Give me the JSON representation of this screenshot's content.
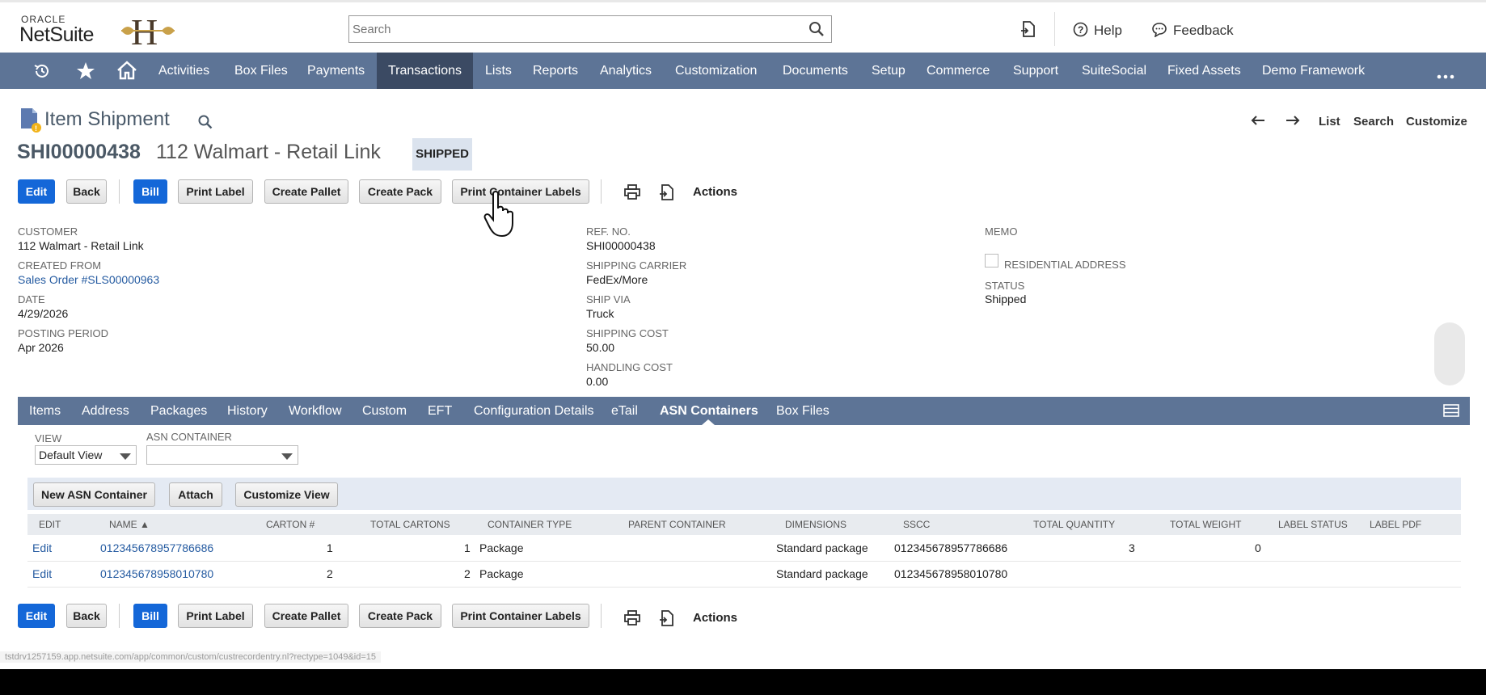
{
  "header": {
    "logo_oracle": "ORACLE",
    "logo_netsuite": "NetSuite",
    "search_placeholder": "Search",
    "help_label": "Help",
    "feedback_label": "Feedback"
  },
  "nav": {
    "items": [
      "Activities",
      "Box Files",
      "Payments",
      "Transactions",
      "Lists",
      "Reports",
      "Analytics",
      "Customization",
      "Documents",
      "Setup",
      "Commerce",
      "Support",
      "SuiteSocial",
      "Fixed Assets",
      "Demo Framework"
    ],
    "active": "Transactions"
  },
  "page": {
    "title": "Item Shipment",
    "record_id": "SHI00000438",
    "record_name": "112 Walmart - Retail Link",
    "status_badge": "SHIPPED",
    "nav_list": "List",
    "nav_search": "Search",
    "nav_customize": "Customize"
  },
  "buttons": {
    "edit": "Edit",
    "back": "Back",
    "bill": "Bill",
    "print_label": "Print Label",
    "create_pallet": "Create Pallet",
    "create_pack": "Create Pack",
    "print_container_labels": "Print Container Labels",
    "actions": "Actions"
  },
  "fields": {
    "customer_label": "Customer",
    "customer_value": "112 Walmart - Retail Link",
    "created_from_label": "Created From",
    "created_from_value": "Sales Order #SLS00000963",
    "date_label": "Date",
    "date_value": "4/29/2026",
    "posting_period_label": "Posting Period",
    "posting_period_value": "Apr 2026",
    "ref_no_label": "Ref. No.",
    "ref_no_value": "SHI00000438",
    "shipping_carrier_label": "Shipping Carrier",
    "shipping_carrier_value": "FedEx/More",
    "ship_via_label": "Ship Via",
    "ship_via_value": "Truck",
    "shipping_cost_label": "Shipping Cost",
    "shipping_cost_value": "50.00",
    "handling_cost_label": "Handling Cost",
    "handling_cost_value": "0.00",
    "memo_label": "Memo",
    "residential_label": "Residential Address",
    "status_label": "Status",
    "status_value": "Shipped"
  },
  "subtabs": {
    "items": [
      "Items",
      "Address",
      "Packages",
      "History",
      "Workflow",
      "Custom",
      "EFT",
      "Configuration Details",
      "eTail",
      "ASN Containers",
      "Box Files"
    ],
    "active": "ASN Containers"
  },
  "sublist": {
    "view_label": "View",
    "view_value": "Default View",
    "asn_label": "ASN Container",
    "asn_value": "",
    "new_button": "New ASN Container",
    "attach_button": "Attach",
    "customize_button": "Customize View",
    "columns": [
      "EDIT",
      "NAME ▲",
      "CARTON #",
      "TOTAL CARTONS",
      "CONTAINER TYPE",
      "PARENT CONTAINER",
      "DIMENSIONS",
      "SSCC",
      "TOTAL QUANTITY",
      "TOTAL WEIGHT",
      "LABEL STATUS",
      "LABEL PDF"
    ],
    "rows": [
      {
        "edit": "Edit",
        "name": "012345678957786686",
        "carton": "1",
        "total_cartons": "1",
        "type": "Package",
        "parent": "",
        "dimensions": "Standard package",
        "sscc": "012345678957786686",
        "qty": "3",
        "weight": "0",
        "label_status": "",
        "label_pdf": ""
      },
      {
        "edit": "Edit",
        "name": "012345678958010780",
        "carton": "2",
        "total_cartons": "2",
        "type": "Package",
        "parent": "",
        "dimensions": "Standard package",
        "sscc": "012345678958010780",
        "qty": "",
        "weight": "",
        "label_status": "",
        "label_pdf": ""
      }
    ]
  },
  "status_url": "tstdrv1257159.app.netsuite.com/app/common/custom/custrecordentry.nl?rectype=1049&id=15",
  "colors": {
    "nav_bg": "#5d7496",
    "nav_active": "#3b4a63",
    "primary_button": "#1467d8",
    "link": "#255ba1"
  }
}
